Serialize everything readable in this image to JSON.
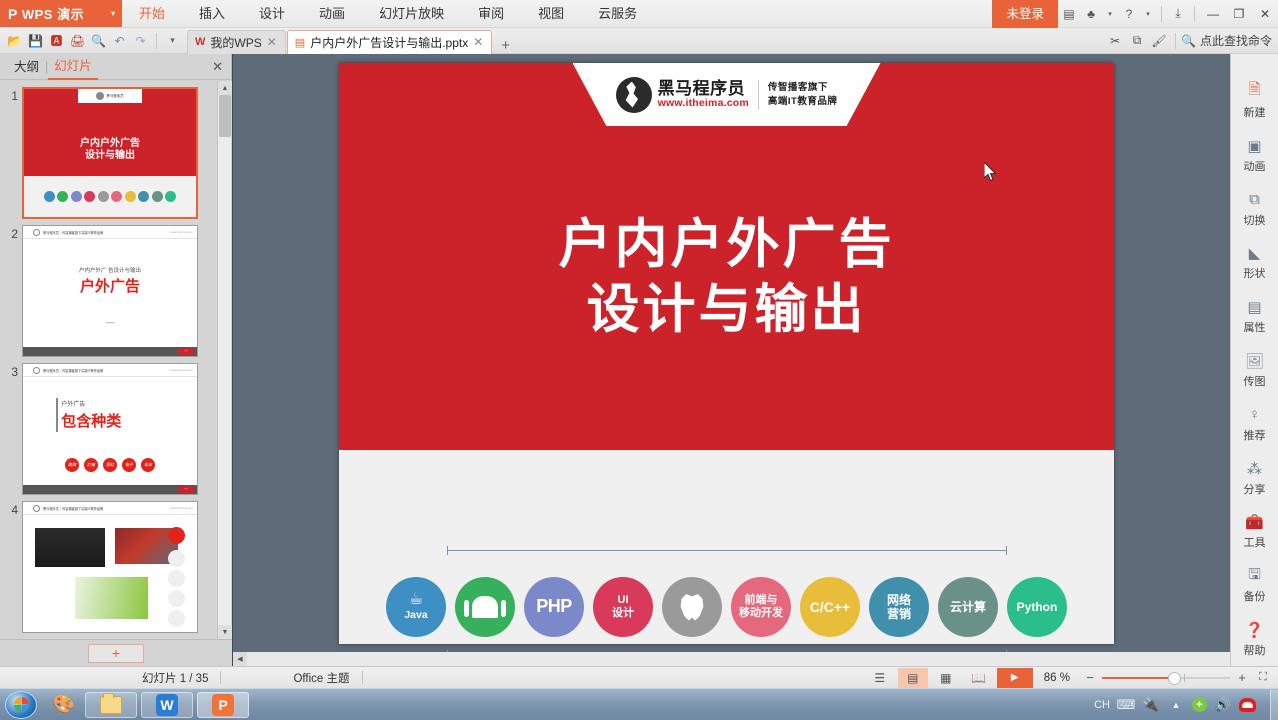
{
  "app": {
    "brand": "WPS 演示",
    "brand_icon": "wps-presentation-icon",
    "caret_icon": "chevron-down-icon"
  },
  "menubar": {
    "items": [
      {
        "label": "开始",
        "active": true
      },
      {
        "label": "插入",
        "active": false
      },
      {
        "label": "设计",
        "active": false
      },
      {
        "label": "动画",
        "active": false
      },
      {
        "label": "幻灯片放映",
        "active": false
      },
      {
        "label": "审阅",
        "active": false
      },
      {
        "label": "视图",
        "active": false
      },
      {
        "label": "云服务",
        "active": false
      }
    ],
    "login_label": "未登录",
    "right_icons": [
      "document-icon",
      "hat-icon",
      "help-icon",
      "download-icon"
    ],
    "window_buttons": [
      "minimize-icon",
      "maximize-icon",
      "close-icon"
    ]
  },
  "tabbar": {
    "quick_icons": [
      "open-folder-icon",
      "save-icon",
      "export-pdf-icon",
      "print-icon",
      "print-preview-icon",
      "undo-icon",
      "redo-icon",
      "customize-caret-icon"
    ],
    "tabs": [
      {
        "label": "我的WPS",
        "icon": "wps-w-icon",
        "active": false
      },
      {
        "label": "户内户外广告设计与输出.pptx",
        "icon": "wps-p-icon",
        "active": true
      }
    ],
    "new_tab_label": "+",
    "right_icons": [
      "scissors-icon",
      "copy-icon",
      "format-painter-icon"
    ],
    "find_placeholder": "点此查找命令",
    "find_icon": "search-icon"
  },
  "left_panel": {
    "tab_outline": "大纲",
    "tab_slides": "幻灯片",
    "separator": "|",
    "close_icon": "close-icon",
    "add_slide_label": "+",
    "scroll_up_icon": "triangle-up-icon",
    "scroll_down_icon": "triangle-down-icon",
    "thumbnails": [
      {
        "number": "1",
        "selected": true,
        "type": "cover",
        "title_line1": "户内户外广告",
        "title_line2": "设计与输出",
        "badge_text": "黑马程序员"
      },
      {
        "number": "2",
        "selected": false,
        "type": "section",
        "sub": "户内户外广 告设计与输出",
        "main": "户外广告",
        "dash": "—",
        "nav": "‹ ›"
      },
      {
        "number": "3",
        "selected": false,
        "type": "list",
        "label": "户外广告",
        "main": "包含种类",
        "circles": [
          "路牌",
          "灯箱",
          "霓虹",
          "电子",
          "车体"
        ],
        "nav": "‹ ›"
      },
      {
        "number": "4",
        "selected": false,
        "type": "images"
      }
    ]
  },
  "slide": {
    "header": {
      "brand_name": "黑马程序员",
      "brand_url": "www.itheima.com",
      "tagline_line1": "传智播客旗下",
      "tagline_line2": "高端IT教育品牌",
      "logo_icon": "heima-horse-logo-icon"
    },
    "title_line1": "户内户外广告",
    "title_line2": "设计与输出",
    "cursor_icon": "mouse-pointer-icon",
    "badges": [
      {
        "label": "Java",
        "sublabel": "",
        "color": "#3d8fc4",
        "icon": "java-cup-icon"
      },
      {
        "label": "",
        "sublabel": "",
        "color": "#36b05c",
        "icon": "android-icon"
      },
      {
        "label": "PHP",
        "sublabel": "",
        "color": "#7b89cb",
        "icon": "php-text-icon"
      },
      {
        "label": "UI",
        "sublabel": "设计",
        "color": "#d93a5a",
        "icon": "ui-design-icon"
      },
      {
        "label": "",
        "sublabel": "",
        "color": "#9a9a9a",
        "icon": "apple-icon"
      },
      {
        "label": "前端与",
        "sublabel": "移动开发",
        "color": "#e4697e",
        "icon": "frontend-icon"
      },
      {
        "label": "C/C++",
        "sublabel": "",
        "color": "#e8bd3a",
        "icon": "cpp-text-icon"
      },
      {
        "label": "网络",
        "sublabel": "营销",
        "color": "#3f8fad",
        "icon": "network-marketing-icon"
      },
      {
        "label": "云计算",
        "sublabel": "",
        "color": "#6a9187",
        "icon": "cloud-computing-icon"
      },
      {
        "label": "Python",
        "sublabel": "",
        "color": "#2bbd8c",
        "icon": "python-text-icon"
      }
    ]
  },
  "right_panel": {
    "items": [
      {
        "label": "新建",
        "icon": "new-document-icon",
        "color": "#e8633a"
      },
      {
        "label": "动画",
        "icon": "animation-icon",
        "color": "#5a6a7a"
      },
      {
        "label": "切换",
        "icon": "transition-icon",
        "color": "#5a6a7a"
      },
      {
        "label": "形状",
        "icon": "shapes-icon",
        "color": "#5a6a7a"
      },
      {
        "label": "属性",
        "icon": "properties-icon",
        "color": "#5a6a7a"
      },
      {
        "label": "传图",
        "icon": "upload-image-icon",
        "color": "#5a6a7a"
      },
      {
        "label": "推荐",
        "icon": "recommend-icon",
        "color": "#5a6a7a"
      },
      {
        "label": "分享",
        "icon": "share-icon",
        "color": "#5a6a7a"
      },
      {
        "label": "工具",
        "icon": "toolbox-icon",
        "color": "#d0442f"
      },
      {
        "label": "备份",
        "icon": "backup-icon",
        "color": "#5a6a7a"
      },
      {
        "label": "帮助",
        "icon": "help-circle-icon",
        "color": "#5a6a7a"
      }
    ]
  },
  "statusbar": {
    "slide_count": "幻灯片 1 / 35",
    "theme": "Office 主题",
    "view_buttons": [
      {
        "icon": "outline-view-icon",
        "active": false
      },
      {
        "icon": "normal-view-icon",
        "active": true
      },
      {
        "icon": "slide-sorter-icon",
        "active": false
      },
      {
        "icon": "reading-view-icon",
        "active": false
      }
    ],
    "play_icon": "play-icon",
    "zoom_label": "86 %",
    "zoom_out": "−",
    "zoom_in": "+",
    "fit_icon": "fit-to-window-icon"
  },
  "taskbar": {
    "start_icon": "windows-start-icon",
    "quick_launch_icon": "show-desktop-icon",
    "items": [
      {
        "icon": "explorer-icon",
        "active": false
      },
      {
        "icon": "wps-writer-icon",
        "active": false
      },
      {
        "icon": "wps-presentation-icon",
        "active": true
      }
    ],
    "tray": {
      "ime_label": "CH",
      "icons": [
        "keyboard-icon",
        "usb-icon",
        "show-hidden-icon",
        "security-icon",
        "volume-icon",
        "cloud-icon"
      ]
    }
  },
  "colors": {
    "accent": "#e8633a",
    "slide_red": "#cc2229",
    "canvas_bg": "#5e6b78"
  }
}
